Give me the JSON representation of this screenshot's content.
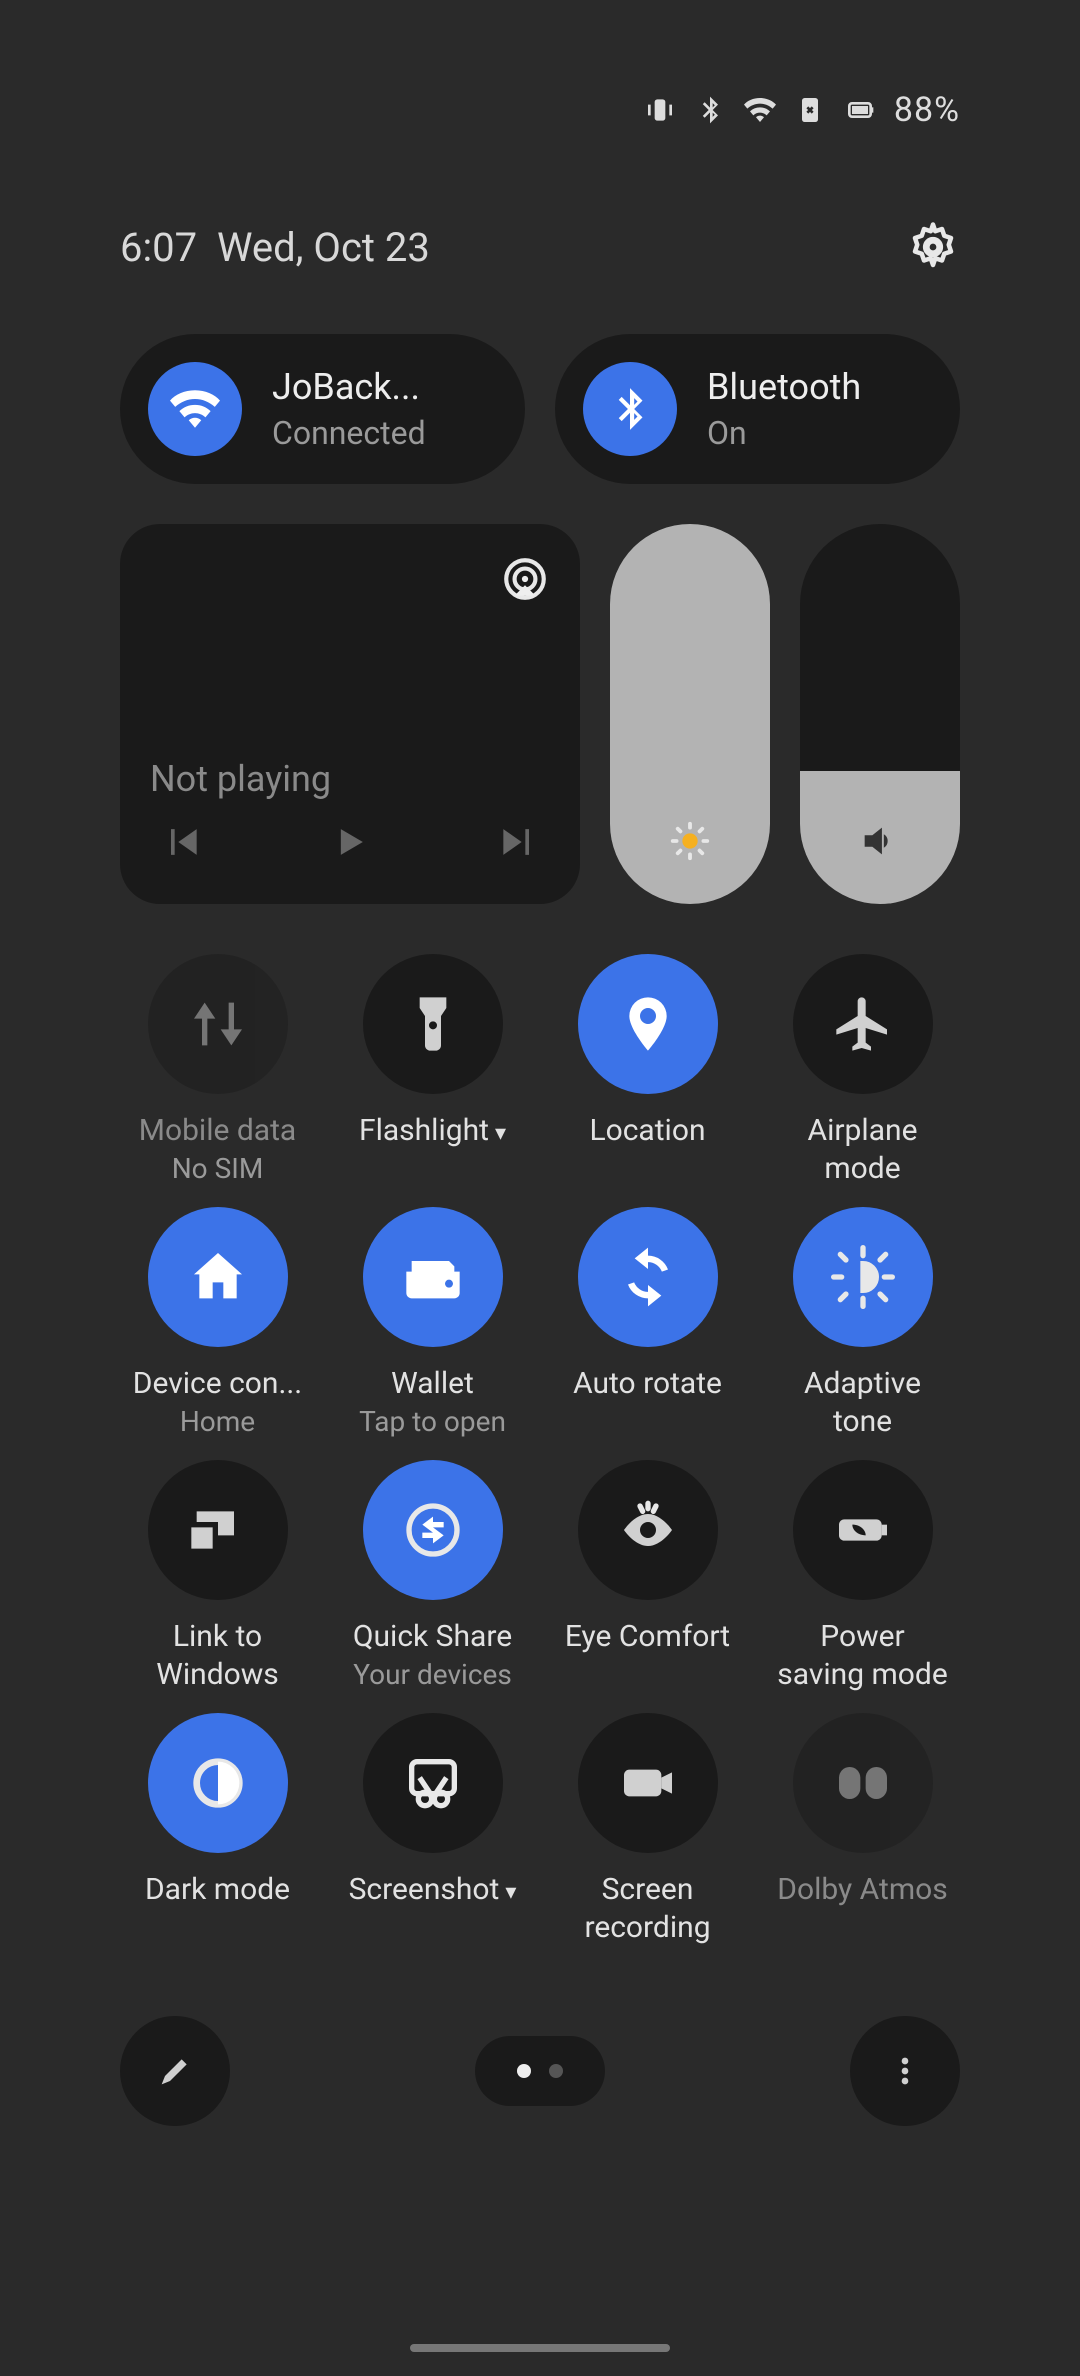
{
  "status": {
    "battery": "88%"
  },
  "header": {
    "time": "6:07",
    "date": "Wed, Oct 23"
  },
  "wifi": {
    "ssid": "JoBack...",
    "status": "Connected"
  },
  "bluetooth": {
    "label": "Bluetooth",
    "status": "On"
  },
  "media": {
    "status": "Not playing"
  },
  "sliders": {
    "brightness_pct": 100,
    "volume_pct": 35
  },
  "tiles": [
    {
      "id": "mobile-data",
      "label": "Mobile data",
      "sub": "No SIM",
      "on": false,
      "disabled": true,
      "icon": "data-arrows"
    },
    {
      "id": "flashlight",
      "label": "Flashlight",
      "sub": "",
      "on": false,
      "disabled": false,
      "icon": "flashlight",
      "dropdown": true
    },
    {
      "id": "location",
      "label": "Location",
      "sub": "",
      "on": true,
      "disabled": false,
      "icon": "location"
    },
    {
      "id": "airplane",
      "label": "Airplane\nmode",
      "sub": "",
      "on": false,
      "disabled": false,
      "icon": "airplane"
    },
    {
      "id": "device-control",
      "label": "Device con...",
      "sub": "Home",
      "on": true,
      "disabled": false,
      "icon": "home"
    },
    {
      "id": "wallet",
      "label": "Wallet",
      "sub": "Tap to open",
      "on": true,
      "disabled": false,
      "icon": "wallet"
    },
    {
      "id": "auto-rotate",
      "label": "Auto rotate",
      "sub": "",
      "on": true,
      "disabled": false,
      "icon": "rotate"
    },
    {
      "id": "adaptive-tone",
      "label": "Adaptive\ntone",
      "sub": "",
      "on": true,
      "disabled": false,
      "icon": "adaptive"
    },
    {
      "id": "link-windows",
      "label": "Link to\nWindows",
      "sub": "",
      "on": false,
      "disabled": false,
      "icon": "devices"
    },
    {
      "id": "quick-share",
      "label": "Quick Share",
      "sub": "Your devices",
      "on": true,
      "disabled": false,
      "icon": "share"
    },
    {
      "id": "eye-comfort",
      "label": "Eye Comfort",
      "sub": "",
      "on": false,
      "disabled": false,
      "icon": "eye"
    },
    {
      "id": "power-saving",
      "label": "Power\nsaving mode",
      "sub": "",
      "on": false,
      "disabled": false,
      "icon": "leaf-battery"
    },
    {
      "id": "dark-mode",
      "label": "Dark mode",
      "sub": "",
      "on": true,
      "disabled": false,
      "icon": "half-circle"
    },
    {
      "id": "screenshot",
      "label": "Screenshot",
      "sub": "",
      "on": false,
      "disabled": false,
      "icon": "scissors",
      "dropdown": true
    },
    {
      "id": "screen-recording",
      "label": "Screen\nrecording",
      "sub": "",
      "on": false,
      "disabled": false,
      "icon": "record"
    },
    {
      "id": "dolby-atmos",
      "label": "Dolby Atmos",
      "sub": "",
      "on": false,
      "disabled": true,
      "icon": "dolby"
    }
  ],
  "pager": {
    "total": 2,
    "active": 0
  },
  "colors": {
    "accent": "#3c73e8",
    "panel": "#1a1a1a",
    "bg": "#2a2a2a"
  }
}
